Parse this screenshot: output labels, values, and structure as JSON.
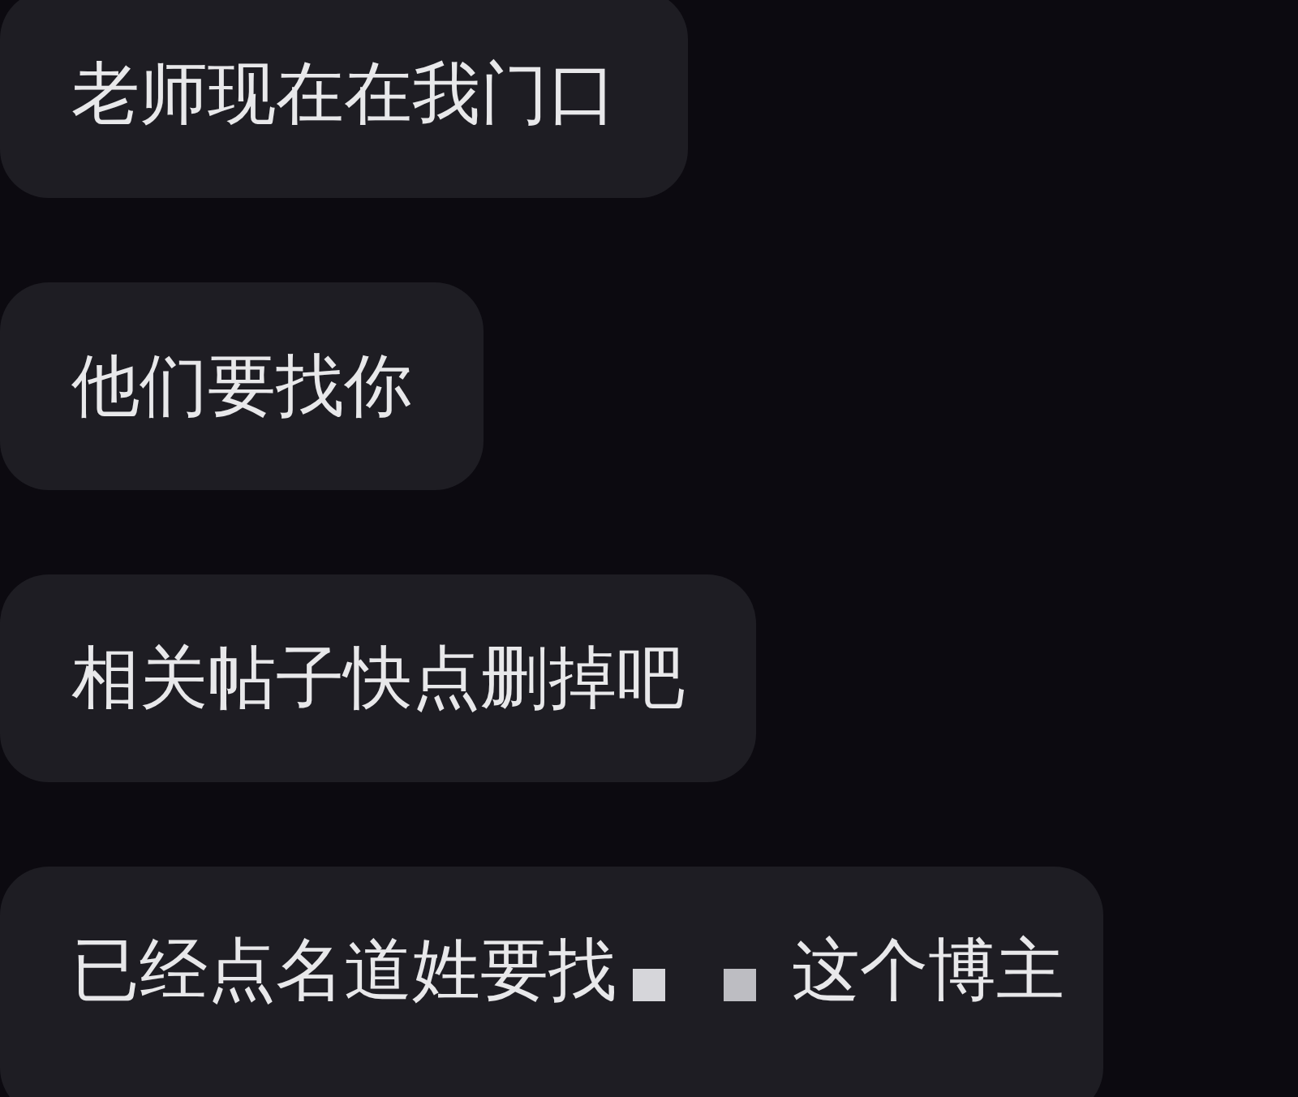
{
  "messages": [
    {
      "parts": [
        {
          "kind": "text",
          "text": "老师现在在我门口"
        }
      ]
    },
    {
      "parts": [
        {
          "kind": "text",
          "text": "他们要找你"
        }
      ]
    },
    {
      "parts": [
        {
          "kind": "text",
          "text": "相关帖子快点删掉吧"
        }
      ]
    },
    {
      "parts": [
        {
          "kind": "text",
          "text": "已经点名道姓要找"
        },
        {
          "kind": "redaction"
        },
        {
          "kind": "text",
          "text": "这个博主"
        }
      ]
    }
  ]
}
